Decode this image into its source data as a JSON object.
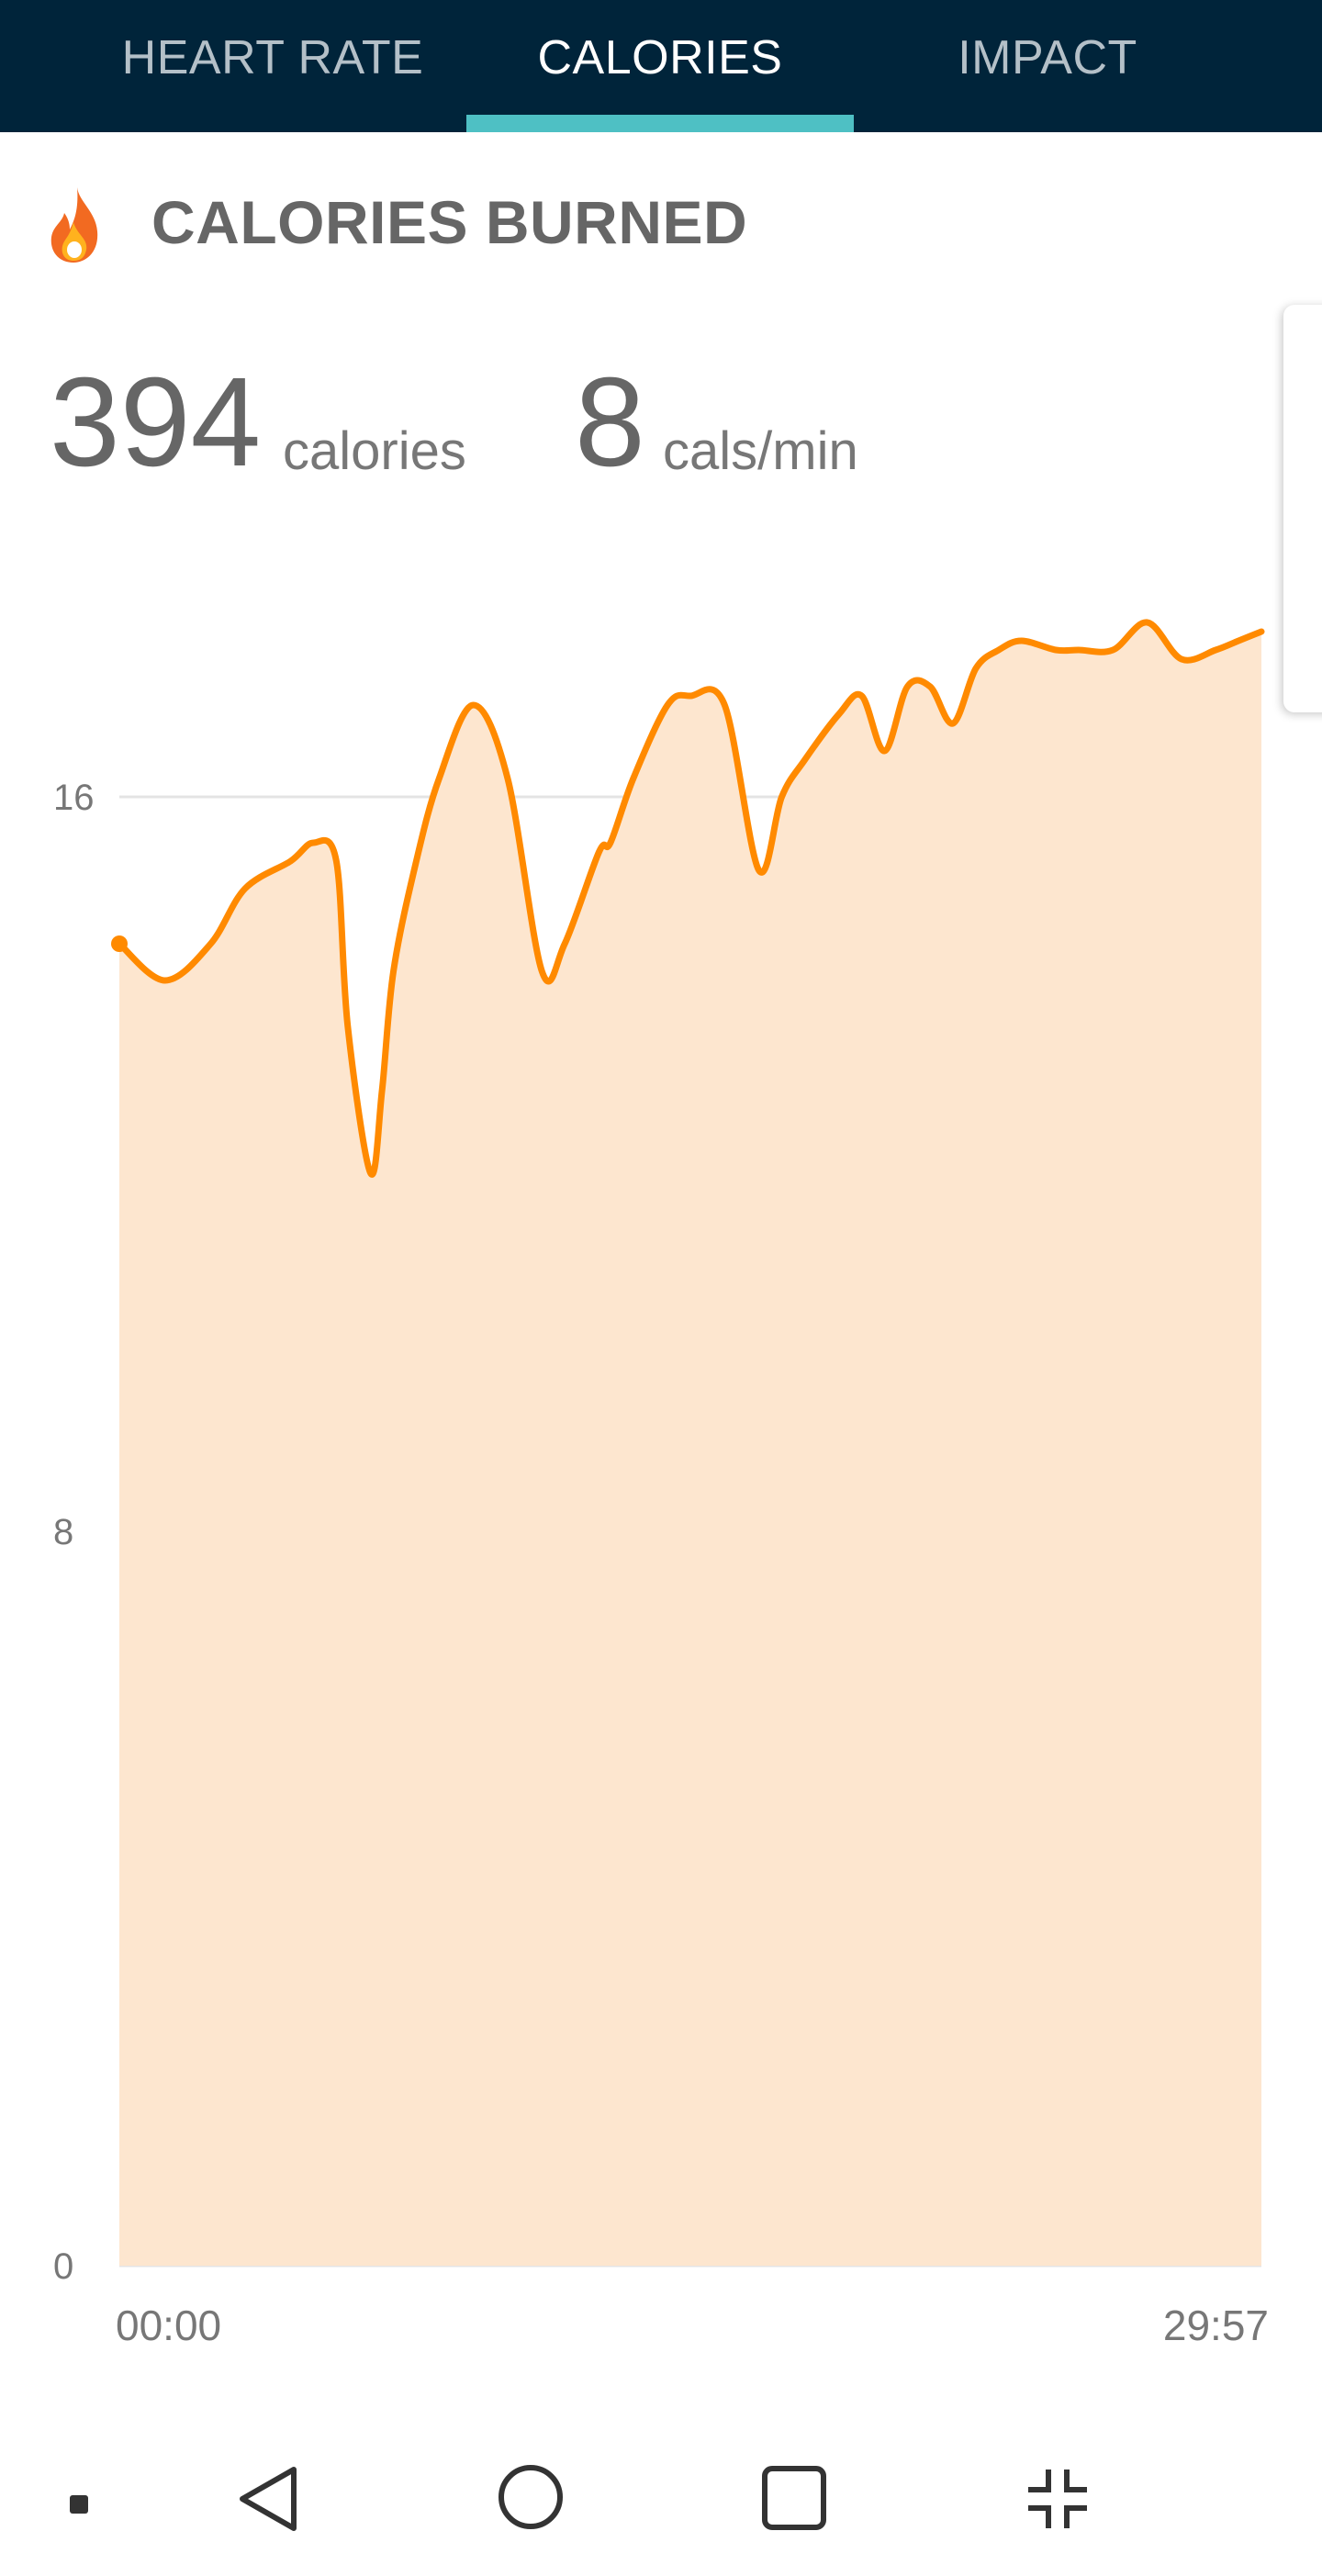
{
  "tabs": [
    {
      "label": "HEART RATE",
      "active": false
    },
    {
      "label": "CALORIES",
      "active": true
    },
    {
      "label": "IMPACT",
      "active": false
    }
  ],
  "header": {
    "icon": "flame-icon",
    "title": "CALORIES BURNED"
  },
  "stats": {
    "total_value": "394",
    "total_unit": "calories",
    "rate_value": "8",
    "rate_unit": "cals/min"
  },
  "colors": {
    "tab_bar": "#00243a",
    "tab_accent": "#4ec0c4",
    "line": "#ff8a00",
    "fill": "#fde6cf",
    "grid": "#e4e4e4"
  },
  "chart_data": {
    "type": "area",
    "x_start_label": "00:00",
    "x_end_label": "29:57",
    "y_ticks": [
      "16",
      "8",
      "0"
    ],
    "ylim": [
      0,
      16
    ],
    "grid": true,
    "x": [
      0.0,
      0.04,
      0.08,
      0.11,
      0.15,
      0.17,
      0.19,
      0.2,
      0.22,
      0.23,
      0.24,
      0.26,
      0.28,
      0.31,
      0.34,
      0.37,
      0.39,
      0.42,
      0.43,
      0.45,
      0.48,
      0.5,
      0.53,
      0.56,
      0.58,
      0.6,
      0.63,
      0.65,
      0.67,
      0.69,
      0.71,
      0.73,
      0.75,
      0.77,
      0.79,
      0.82,
      0.84,
      0.87,
      0.9,
      0.93,
      0.96,
      0.98,
      1.0
    ],
    "values": [
      14.4,
      14.0,
      14.4,
      15.0,
      15.3,
      15.5,
      15.3,
      13.5,
      11.9,
      12.8,
      14.1,
      15.3,
      16.2,
      17.0,
      16.2,
      14.1,
      14.4,
      15.4,
      15.5,
      16.2,
      17.0,
      17.1,
      17.0,
      15.2,
      16.0,
      16.4,
      16.9,
      17.1,
      16.5,
      17.2,
      17.2,
      16.8,
      17.4,
      17.6,
      17.7,
      17.6,
      17.6,
      17.6,
      17.9,
      17.5,
      17.6,
      17.7,
      17.8
    ]
  },
  "navbar": {
    "items": [
      "dot-icon",
      "back-triangle-icon",
      "home-circle-icon",
      "recents-square-icon",
      "collapse-icon"
    ]
  }
}
